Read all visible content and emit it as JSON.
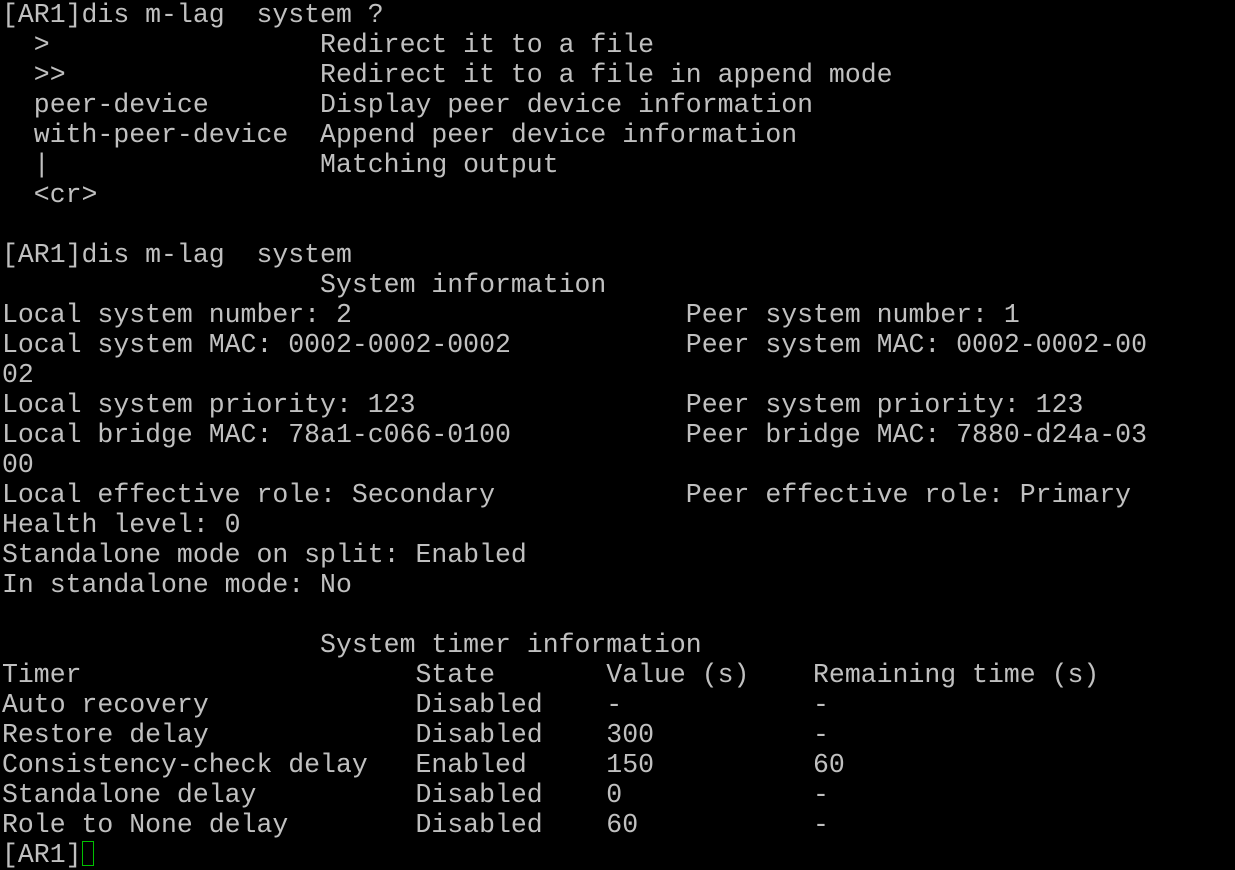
{
  "colors": {
    "background": "#000000",
    "foreground": "#c0c0c0",
    "cursor": "#00c000"
  },
  "terminal": {
    "lines": [
      "[AR1]dis m-lag  system ?",
      "  >                 Redirect it to a file",
      "  >>                Redirect it to a file in append mode",
      "  peer-device       Display peer device information",
      "  with-peer-device  Append peer device information",
      "  |                 Matching output",
      "  <cr>",
      "",
      "[AR1]dis m-lag  system",
      "                    System information",
      "Local system number: 2                     Peer system number: 1",
      "Local system MAC: 0002-0002-0002           Peer system MAC: 0002-0002-00",
      "02",
      "Local system priority: 123                 Peer system priority: 123",
      "Local bridge MAC: 78a1-c066-0100           Peer bridge MAC: 7880-d24a-03",
      "00",
      "Local effective role: Secondary            Peer effective role: Primary",
      "Health level: 0",
      "Standalone mode on split: Enabled",
      "In standalone mode: No",
      "",
      "                    System timer information",
      "Timer                     State       Value (s)    Remaining time (s)",
      "Auto recovery             Disabled    -            -",
      "Restore delay             Disabled    300          -",
      "Consistency-check delay   Enabled     150          60",
      "Standalone delay          Disabled    0            -",
      "Role to None delay        Disabled    60           -"
    ],
    "prompt": "[AR1]"
  }
}
